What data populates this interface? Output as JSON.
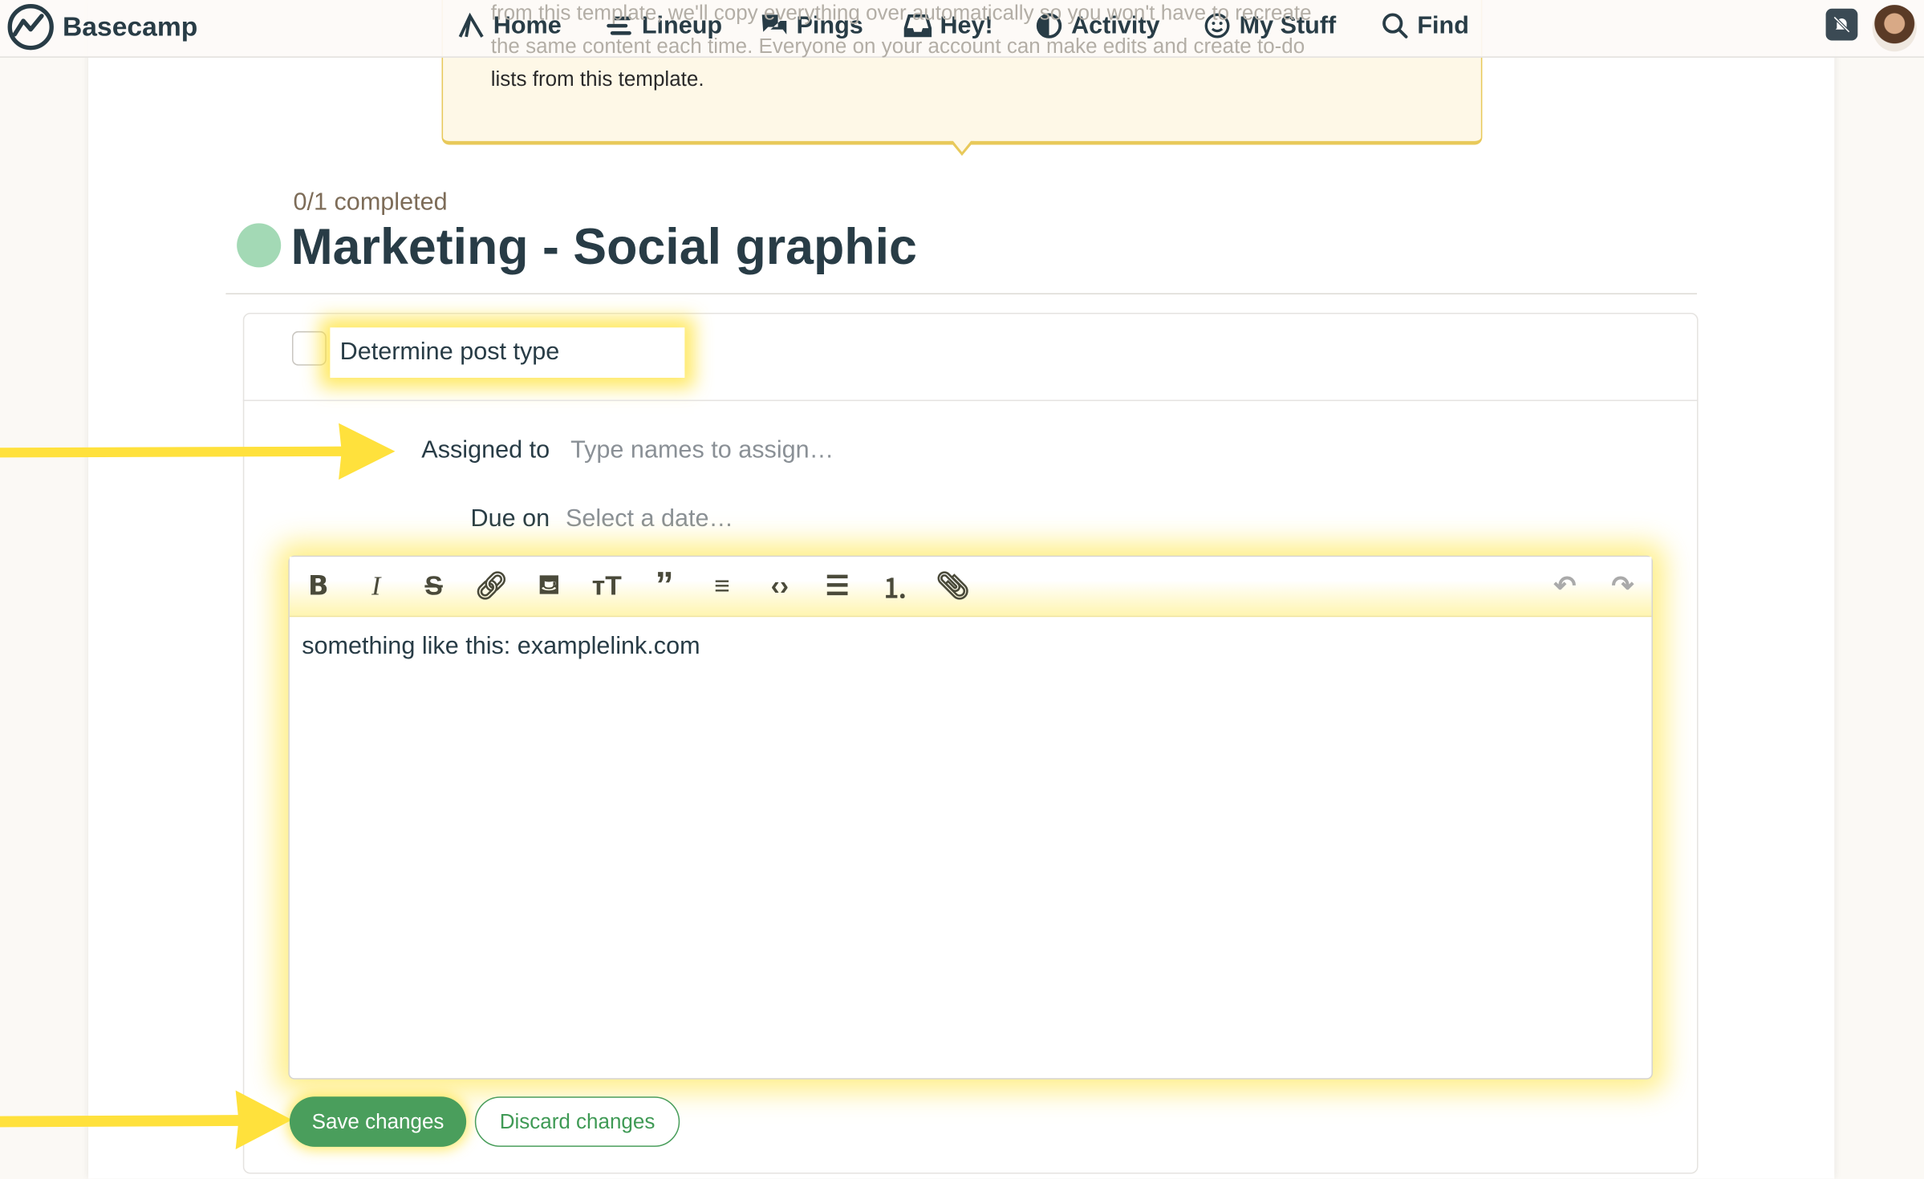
{
  "header": {
    "logo": "Basecamp",
    "nav": [
      {
        "label": "Home",
        "icon": "home-icon"
      },
      {
        "label": "Lineup",
        "icon": "lineup-icon"
      },
      {
        "label": "Pings",
        "icon": "pings-icon"
      },
      {
        "label": "Hey!",
        "icon": "hey-icon"
      },
      {
        "label": "Activity",
        "icon": "activity-icon"
      },
      {
        "label": "My Stuff",
        "icon": "my-stuff-icon"
      },
      {
        "label": "Find",
        "icon": "search-icon"
      }
    ]
  },
  "tooltip": {
    "lines": [
      "from this template, we'll copy everything over automatically so you won't have to recreate",
      "the same content each time. Everyone on your account can make edits and create to-do",
      "lists from this template."
    ]
  },
  "list": {
    "progress": "0/1 completed",
    "title": "Marketing - Social graphic",
    "status_color": "#a3d9b5"
  },
  "todo": {
    "title": "Determine post type",
    "assigned_label": "Assigned to",
    "assigned_placeholder": "Type names to assign…",
    "due_label": "Due on",
    "due_placeholder": "Select a date…",
    "notes": "something like this: examplelink.com",
    "save_label": "Save changes",
    "discard_label": "Discard changes"
  },
  "colors": {
    "accent": "#4a9e5c",
    "highlight": "#ffe43c"
  }
}
